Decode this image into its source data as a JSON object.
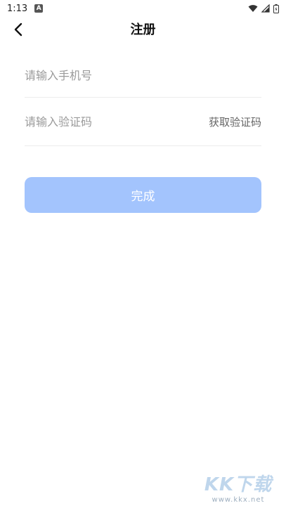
{
  "status_bar": {
    "time": "1:13",
    "notification_icon": "A"
  },
  "header": {
    "title": "注册"
  },
  "form": {
    "phone": {
      "value": "",
      "placeholder": "请输入手机号"
    },
    "code": {
      "value": "",
      "placeholder": "请输入验证码",
      "get_code_label": "获取验证码"
    },
    "submit_label": "完成"
  },
  "watermark": {
    "logo_text": "KK下载",
    "url": "www.kkx.net"
  },
  "colors": {
    "button_bg": "#a3c4fd",
    "button_text": "#ffffff",
    "placeholder": "#9a9a9a",
    "divider": "#ececec"
  }
}
